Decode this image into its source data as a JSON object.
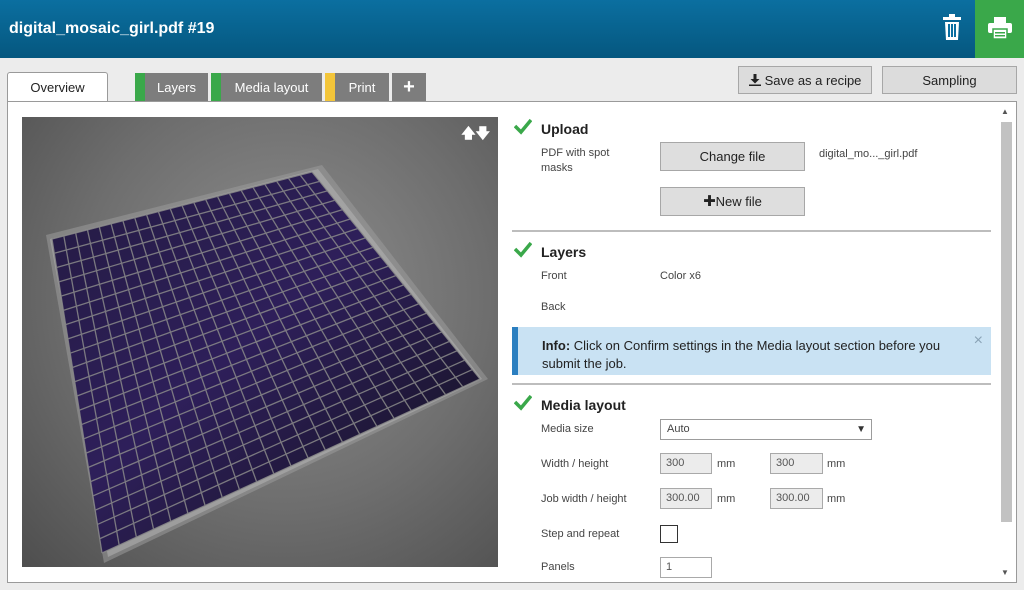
{
  "header": {
    "title": "digital_mosaic_girl.pdf #19",
    "icons": [
      "trash-icon",
      "print-icon"
    ],
    "accent": "#3aa84a",
    "bar_color": "#05577f"
  },
  "tabs": {
    "overview": "Overview",
    "layers": "Layers",
    "media_layout": "Media layout",
    "print": "Print",
    "add": "+",
    "stripe_colors": {
      "layers": "#3aa84a",
      "media_layout": "#3aa84a",
      "print": "#f3c53a"
    }
  },
  "toolbar": {
    "save_recipe": "Save as a recipe",
    "sampling": "Sampling"
  },
  "preview": {
    "arrows": "🡅🡇"
  },
  "upload": {
    "title": "Upload",
    "pdf_label": "PDF with spot masks",
    "change_file": "Change file",
    "filename": "digital_mo..._girl.pdf",
    "new_file": "New file"
  },
  "layers": {
    "title": "Layers",
    "front_label": "Front",
    "front_value": "Color x6",
    "back_label": "Back"
  },
  "info": {
    "prefix": "Info:",
    "message": "Click on Confirm settings in the Media layout section before you submit the job."
  },
  "media_layout": {
    "title": "Media layout",
    "media_size_label": "Media size",
    "media_size_value": "Auto",
    "wh_label": "Width / height",
    "width": "300",
    "height": "300",
    "unit": "mm",
    "job_wh_label": "Job width / height",
    "job_width": "300.00",
    "job_height": "300.00",
    "step_repeat_label": "Step and repeat",
    "panels_label": "Panels",
    "panels_value": "1"
  }
}
